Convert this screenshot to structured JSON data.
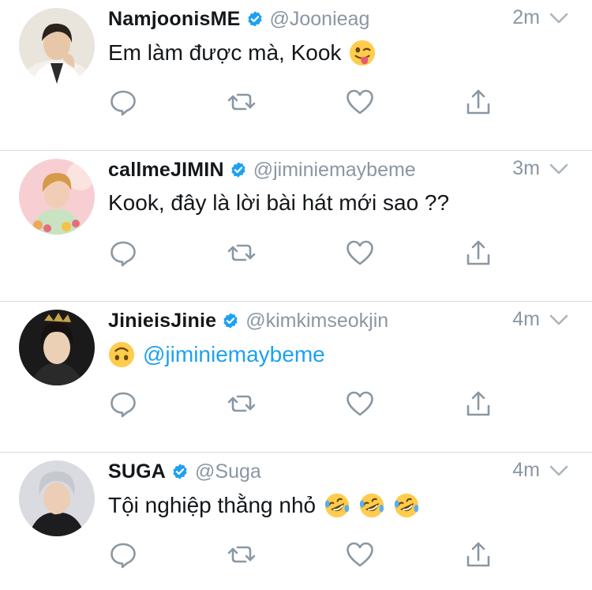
{
  "colors": {
    "name": "#14171a",
    "secondary": "#8a97a3",
    "verified": "#1da1f2",
    "mention": "#1da1f2",
    "divider": "#d6dbe0"
  },
  "tweets": [
    {
      "display_name": "NamjoonisME",
      "handle": "@Joonieag",
      "time": "2m",
      "verified": true,
      "text": "Em làm được mà, Kook",
      "emoji": [
        "winking-face-with-tongue"
      ]
    },
    {
      "display_name": "callmeJIMIN",
      "handle": "@jiminiemaybeme",
      "time": "3m",
      "verified": true,
      "text": "Kook, đây là lời bài hát mới sao ??",
      "emoji": []
    },
    {
      "display_name": "JinieisJinie",
      "handle": "@kimkimseokjin",
      "time": "4m",
      "verified": true,
      "text_mention": "@jiminiemaybeme",
      "emoji": [
        "upside-down-face"
      ]
    },
    {
      "display_name": "SUGA",
      "handle": "@Suga",
      "time": "4m",
      "verified": true,
      "text": "Tội nghiệp thằng nhỏ",
      "emoji": [
        "rolling-on-floor-laughing",
        "rolling-on-floor-laughing",
        "rolling-on-floor-laughing"
      ]
    }
  ],
  "action_icons": [
    "reply-icon",
    "retweet-icon",
    "like-icon",
    "share-icon"
  ]
}
